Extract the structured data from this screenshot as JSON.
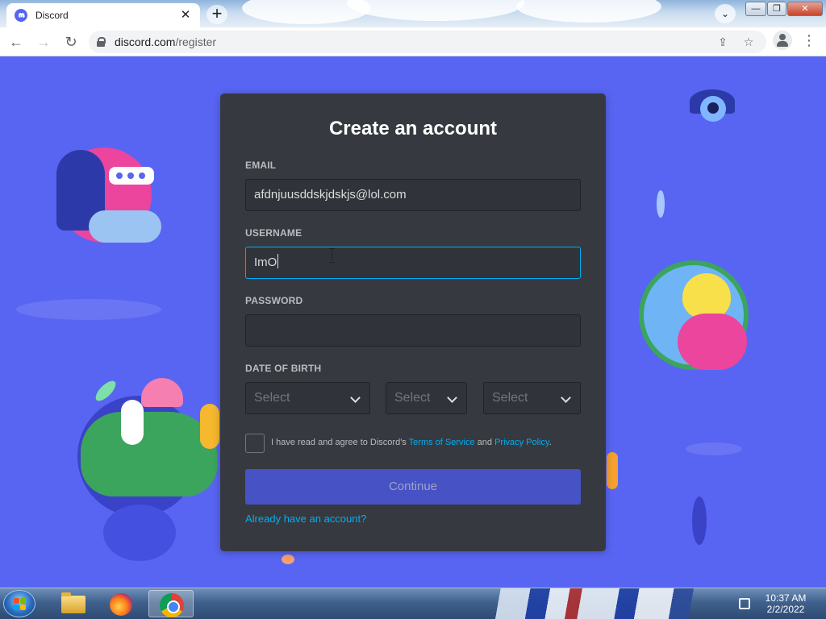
{
  "browser": {
    "tab_title": "Discord",
    "tab_close": "✕",
    "new_tab": "+",
    "url_host": "discord.com",
    "url_path": "/register",
    "back": "←",
    "forward": "→",
    "reload": "↻",
    "share": "⇪",
    "star": "☆",
    "menu": "⋮",
    "tab_search": "⌄",
    "minimize": "—",
    "maximize": "❐",
    "close": "✕"
  },
  "form": {
    "title": "Create an account",
    "email_label": "EMAIL",
    "email_value": "afdnjuusddskjdskjs@lol.com",
    "username_label": "USERNAME",
    "username_value": "ImO",
    "password_label": "PASSWORD",
    "password_value": "",
    "dob_label": "DATE OF BIRTH",
    "month_placeholder": "Select",
    "day_placeholder": "Select",
    "year_placeholder": "Select",
    "tos_prefix": "I have read and agree to Discord's ",
    "tos_link": "Terms of Service",
    "tos_and": " and ",
    "privacy_link": "Privacy Policy",
    "tos_suffix": ".",
    "continue_label": "Continue",
    "login_link": "Already have an account?"
  },
  "taskbar": {
    "time": "10:37 AM",
    "date": "2/2/2022"
  },
  "colors": {
    "brand": "#5865f2",
    "card": "#36393f",
    "input": "#303339",
    "focus": "#00aff4",
    "button": "#4752c4",
    "link": "#00aff4"
  }
}
